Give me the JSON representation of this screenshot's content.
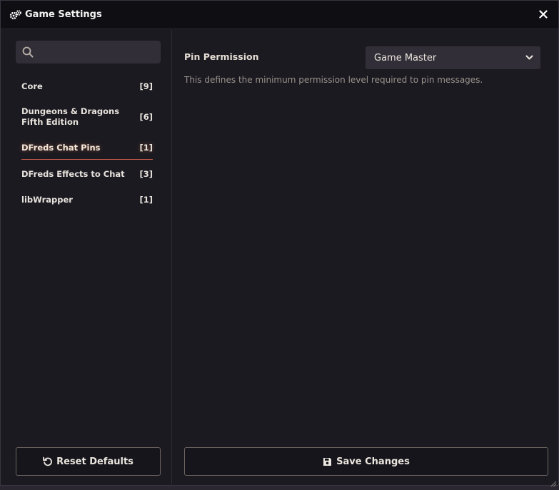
{
  "window": {
    "title": "Game Settings",
    "title_icon": "cogs-icon",
    "close_icon": "close-icon"
  },
  "sidebar": {
    "search": {
      "value": "",
      "placeholder": "",
      "icon": "search-icon"
    },
    "categories": [
      {
        "label": "Core",
        "count": "[9]",
        "active": false
      },
      {
        "label": "Dungeons & Dragons Fifth Edition",
        "count": "[6]",
        "active": false
      },
      {
        "label": "DFreds Chat Pins",
        "count": "[1]",
        "active": true
      },
      {
        "label": "DFreds Effects to Chat",
        "count": "[3]",
        "active": false
      },
      {
        "label": "libWrapper",
        "count": "[1]",
        "active": false
      }
    ],
    "reset_button": {
      "label": "Reset Defaults",
      "icon": "undo-icon"
    }
  },
  "main": {
    "setting": {
      "label": "Pin Permission",
      "select_value": "Game Master",
      "hint": "This defines the minimum permission level required to pin messages."
    },
    "save_button": {
      "label": "Save Changes",
      "icon": "save-icon"
    }
  },
  "colors": {
    "window_bg": "#1b1a21",
    "titlebar_bg": "#0f0e13",
    "input_bg": "#322e37",
    "active_underline": "#c45a4a"
  }
}
